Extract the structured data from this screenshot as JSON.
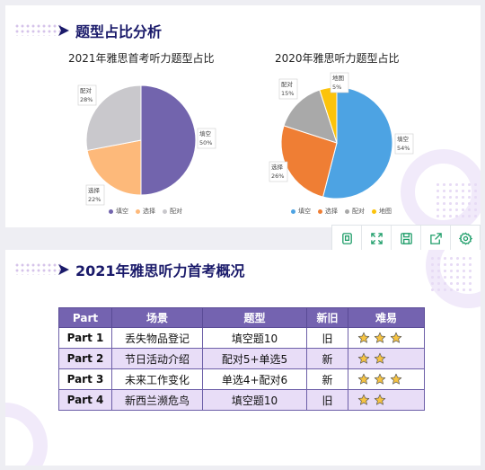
{
  "slide1": {
    "title": "题型占比分析",
    "chart_titles": [
      "2021年雅思首考听力题型占比",
      "2020年雅思听力题型占比"
    ]
  },
  "chart_data": [
    {
      "type": "pie",
      "title": "2021年雅思首考听力题型占比",
      "slices": [
        {
          "name": "填空",
          "value": 50,
          "label": "50%",
          "color": "#7264ad"
        },
        {
          "name": "选择",
          "value": 22,
          "label": "22%",
          "color": "#fdb97a"
        },
        {
          "name": "配对",
          "value": 28,
          "label": "28%",
          "color": "#c9c8cc"
        }
      ],
      "legend": [
        "填空",
        "选择",
        "配对"
      ],
      "legend_position": "bottom"
    },
    {
      "type": "pie",
      "title": "2020年雅思听力题型占比",
      "slices": [
        {
          "name": "填空",
          "value": 54,
          "label": "54%",
          "color": "#4da3e3"
        },
        {
          "name": "选择",
          "value": 26,
          "label": "26%",
          "color": "#ef7e34"
        },
        {
          "name": "配对",
          "value": 15,
          "label": "15%",
          "color": "#a9a9a9"
        },
        {
          "name": "地图",
          "value": 5,
          "label": "5%",
          "color": "#fcc30b"
        }
      ],
      "legend": [
        "填空",
        "选择",
        "配对",
        "地图"
      ],
      "legend_position": "bottom"
    }
  ],
  "slide2": {
    "title": "2021年雅思听力首考概况",
    "table": {
      "headers": [
        "Part",
        "场景",
        "题型",
        "新旧",
        "难易"
      ],
      "rows": [
        {
          "part": "Part 1",
          "scene": "丢失物品登记",
          "type": "填空题10",
          "age": "旧",
          "stars": 3
        },
        {
          "part": "Part 2",
          "scene": "节日活动介绍",
          "type": "配对5+单选5",
          "age": "新",
          "stars": 2
        },
        {
          "part": "Part 3",
          "scene": "未来工作变化",
          "type": "单选4+配对6",
          "age": "新",
          "stars": 3
        },
        {
          "part": "Part 4",
          "scene": "新西兰濒危鸟",
          "type": "填空题10",
          "age": "旧",
          "stars": 2
        }
      ]
    }
  },
  "toolbar": {
    "icons": [
      "copy-icon",
      "fullscreen-icon",
      "save-icon",
      "share-icon",
      "settings-icon"
    ]
  },
  "colors": {
    "title_navy": "#1a1a6a",
    "table_header": "#7463b0",
    "table_alt_row": "#e8ddf7",
    "star": "#f6c342"
  }
}
